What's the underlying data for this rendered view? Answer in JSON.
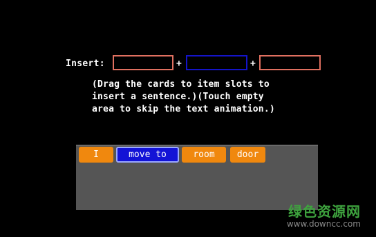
{
  "insert": {
    "label": "Insert:",
    "plus_1": "+",
    "plus_2": "+",
    "slot_colors": [
      "#e07060",
      "#1414c8",
      "#e07060"
    ]
  },
  "instructions": "(Drag the cards to item slots to\ninsert a sentence.)(Touch empty\narea to skip the text animation.)",
  "cards": [
    {
      "label": "I",
      "color": "#f0880e"
    },
    {
      "label": "move to",
      "color": "#1313d6"
    },
    {
      "label": "room",
      "color": "#f0880e"
    },
    {
      "label": "door",
      "color": "#f0880e"
    }
  ],
  "watermark": {
    "title": "绿色资源网",
    "url": "www.downcc.com"
  }
}
